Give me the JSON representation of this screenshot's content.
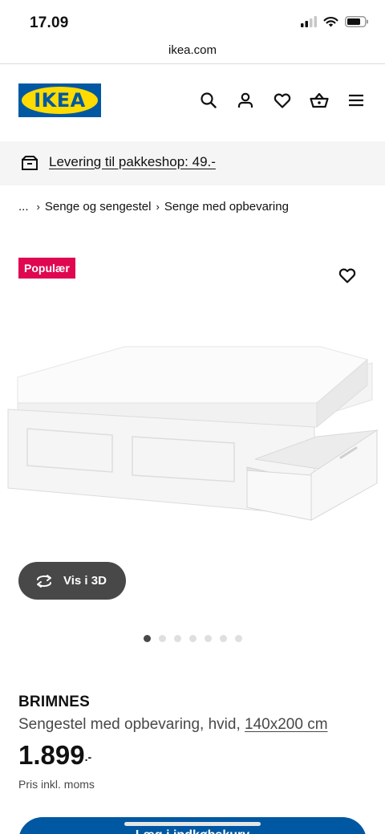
{
  "status": {
    "time": "17.09"
  },
  "browser": {
    "url": "ikea.com"
  },
  "header": {
    "logo_text": "IKEA"
  },
  "delivery": {
    "text": "Levering til pakkeshop: 49.-"
  },
  "breadcrumb": {
    "ellipsis": "...",
    "items": [
      "Senge og sengestel",
      "Senge med opbevaring"
    ]
  },
  "badge": {
    "label": "Populær"
  },
  "view3d": {
    "label": "Vis i 3D"
  },
  "gallery": {
    "current": 1,
    "total": 7
  },
  "product": {
    "name": "BRIMNES",
    "description": "Sengestel med opbevaring, hvid,",
    "size": "140x200 cm",
    "price": "1.899",
    "price_suffix": ".-",
    "price_note": "Pris inkl. moms"
  },
  "cart": {
    "label": "Læg i indkøbskurv"
  },
  "colors": {
    "brand_blue": "#0058a3",
    "brand_yellow": "#ffdb00",
    "badge": "#e00751"
  }
}
